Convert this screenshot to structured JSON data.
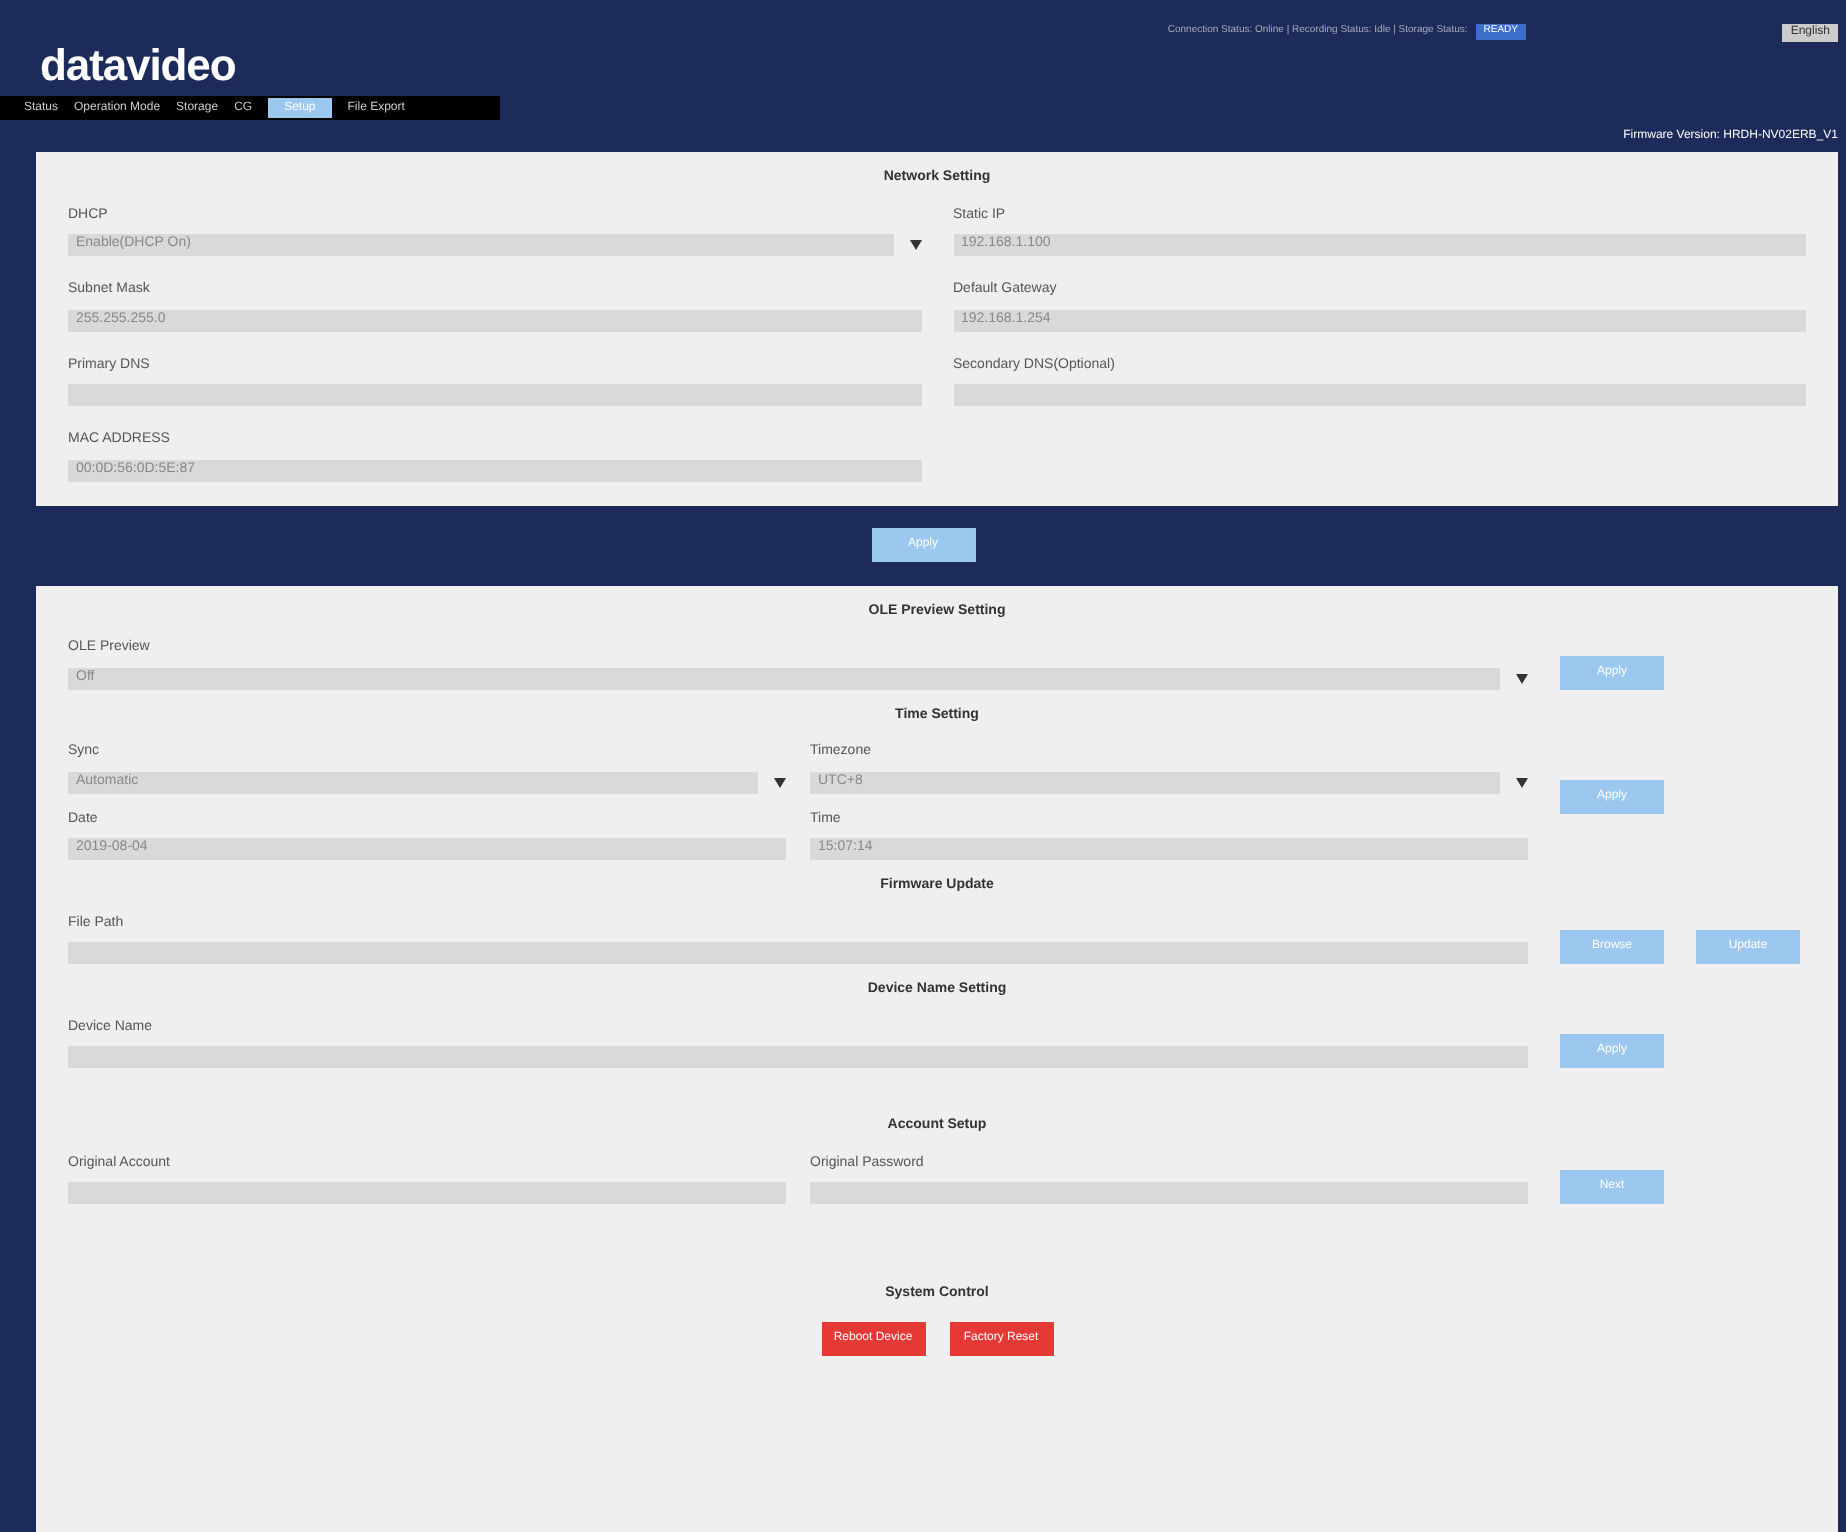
{
  "header": {
    "logo": "datavideo",
    "status_text": "Connection Status: Online | Recording Status: Idle | Storage Status:",
    "status_badge": "READY",
    "language": "English"
  },
  "tabs": [
    {
      "label": "Status",
      "selected": false
    },
    {
      "label": "Operation Mode",
      "selected": false
    },
    {
      "label": "Storage",
      "selected": false
    },
    {
      "label": "CG",
      "selected": false
    },
    {
      "label": "Setup",
      "selected": true
    },
    {
      "label": "File Export",
      "selected": false
    }
  ],
  "firmware_version": "Firmware Version: HRDH-NV02ERB_V1",
  "network": {
    "title": "Network Setting",
    "fields": [
      {
        "label": "DHCP",
        "value": "Enable(DHCP On)",
        "kind": "select"
      },
      {
        "label": "Static IP",
        "value": "192.168.1.100",
        "kind": "input"
      },
      {
        "label": "Subnet Mask",
        "value": "255.255.255.0",
        "kind": "input"
      },
      {
        "label": "Default Gateway",
        "value": "192.168.1.254",
        "kind": "input"
      },
      {
        "label": "Primary DNS",
        "kind": "input"
      },
      {
        "label": "Secondary DNS(Optional)",
        "kind": "input"
      },
      {
        "label": "MAC ADDRESS",
        "value": "00:0D:56:0D:5E:87",
        "kind": "input"
      }
    ],
    "apply": "Apply"
  },
  "osd": {
    "title": "OLE Preview Setting",
    "label": "OLE Preview",
    "value": "Off",
    "button": "Apply"
  },
  "time": {
    "title": "Time Setting",
    "sync_label": "Sync",
    "sync_value": "Automatic",
    "timezone_label": "Timezone",
    "timezone_value": "UTC+8",
    "date_label": "Date",
    "date_value": "2019-08-04",
    "time_label": "Time",
    "time_value": "15:07:14",
    "button": "Apply"
  },
  "firmware": {
    "title": "Firmware Update",
    "label": "File Path",
    "browse": "Browse",
    "update": "Update"
  },
  "device": {
    "title": "Device Name Setting",
    "label": "Device Name",
    "button": "Apply"
  },
  "account": {
    "title": "Account Setup",
    "account_label": "Original Account",
    "password_label": "Original Password",
    "button": "Next"
  },
  "system": {
    "title": "System Control",
    "buttons": [
      "Reboot Device",
      "Factory Reset"
    ]
  }
}
